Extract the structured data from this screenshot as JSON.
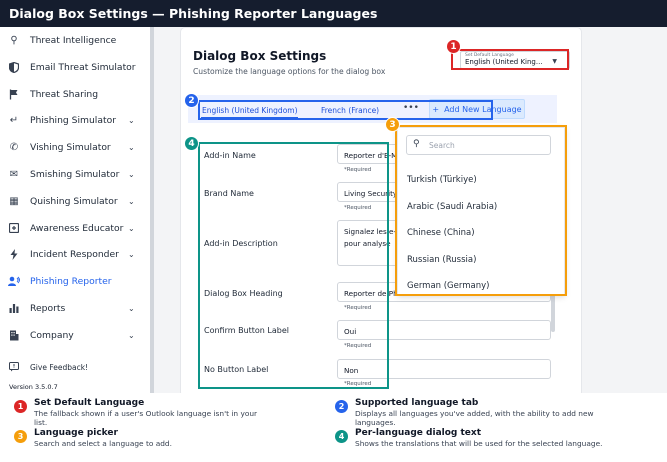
{
  "title": "Dialog Box Settings — Phishing Reporter Languages",
  "sidebar": {
    "items": [
      {
        "label": "Threat Intelligence",
        "icon": "search-icon",
        "chevron": false,
        "active": false
      },
      {
        "label": "Email Threat Simulator",
        "icon": "shield-icon",
        "chevron": false,
        "active": false
      },
      {
        "label": "Threat Sharing",
        "icon": "flag-icon",
        "chevron": false,
        "active": false
      },
      {
        "label": "Phishing Simulator",
        "icon": "hook-icon",
        "chevron": true,
        "active": false
      },
      {
        "label": "Vishing Simulator",
        "icon": "phone-icon",
        "chevron": true,
        "active": false
      },
      {
        "label": "Smishing Simulator",
        "icon": "sms-icon",
        "chevron": true,
        "active": false
      },
      {
        "label": "Quishing Simulator",
        "icon": "qr-code-icon",
        "chevron": true,
        "active": false
      },
      {
        "label": "Awareness Educator",
        "icon": "graduation-cap-icon",
        "chevron": true,
        "active": false
      },
      {
        "label": "Incident Responder",
        "icon": "bolt-icon",
        "chevron": true,
        "active": false
      },
      {
        "label": "Phishing Reporter",
        "icon": "user-report-icon",
        "chevron": false,
        "active": true
      },
      {
        "label": "Reports",
        "icon": "bar-chart-icon",
        "chevron": true,
        "active": false
      },
      {
        "label": "Company",
        "icon": "building-icon",
        "chevron": true,
        "active": false
      }
    ],
    "feedback": "Give Feedback!",
    "version": "Version 3.5.0.7"
  },
  "main": {
    "card_title": "Dialog Box Settings",
    "card_subtitle": "Customize the language options for the dialog box",
    "default_language": {
      "mini_label": "Set Default Language",
      "value": "English (United King..."
    },
    "tabs": [
      "English (United Kingdom)",
      "French (France)"
    ],
    "more": "•••",
    "add_language": "Add New Language",
    "fields": [
      {
        "label": "Add-in Name",
        "value": "Reporter d'E-Ma",
        "required": "*Required"
      },
      {
        "label": "Brand Name",
        "value": "Living Security",
        "required": "*Required"
      },
      {
        "label": "Add-in Description",
        "value": "Signalez les e-m",
        "value2": "pour analyse",
        "required": ""
      },
      {
        "label": "Dialog Box Heading",
        "value": "Reporter de Phi",
        "required": "*Required"
      },
      {
        "label": "Confirm Button Label",
        "value": "Oui",
        "required": "*Required"
      },
      {
        "label": "No Button Label",
        "value": "Non",
        "required": "*Required"
      }
    ]
  },
  "picker": {
    "placeholder": "Search",
    "options": [
      "Turkish (Türkiye)",
      "Arabic (Saudi Arabia)",
      "Chinese (China)",
      "Russian (Russia)",
      "German (Germany)"
    ]
  },
  "callouts": [
    {
      "num": "1",
      "color": "#dc2626"
    },
    {
      "num": "2",
      "color": "#2563eb"
    },
    {
      "num": "3",
      "color": "#f59e0b"
    },
    {
      "num": "4",
      "color": "#0d9488"
    }
  ],
  "legend": [
    {
      "num": "1",
      "title": "Set Default Language",
      "desc": "The fallback shown if a user's Outlook language isn't in your list."
    },
    {
      "num": "2",
      "title": "Supported language tab",
      "desc": "Displays all languages you've added, with the ability to add new languages."
    },
    {
      "num": "3",
      "title": "Language picker",
      "desc": "Search and select a language to add."
    },
    {
      "num": "4",
      "title": "Per-language dialog text",
      "desc": "Shows the translations that will be used for the selected language."
    }
  ]
}
